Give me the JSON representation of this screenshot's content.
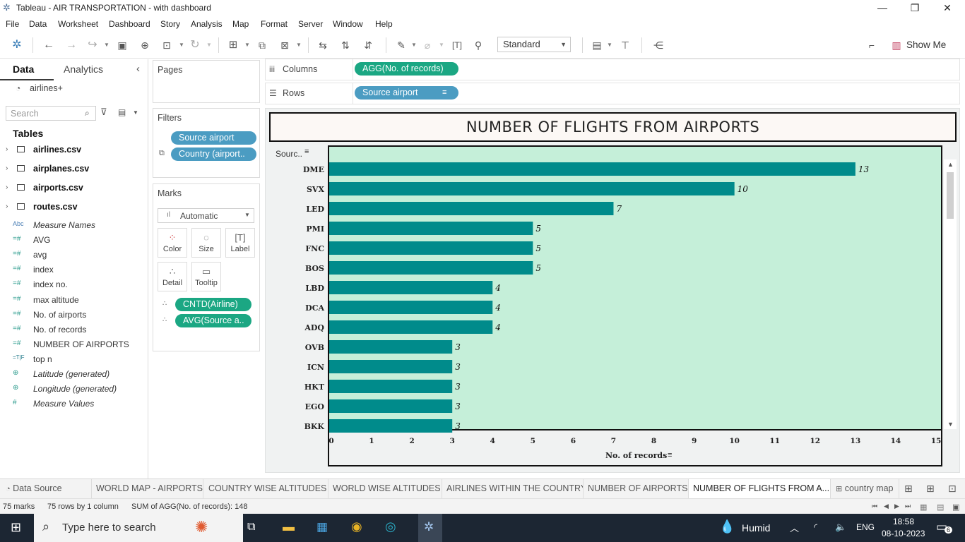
{
  "window": {
    "title": "Tableau - AIR TRANSPORTATION - with dashboard"
  },
  "menu": [
    "File",
    "Data",
    "Worksheet",
    "Dashboard",
    "Story",
    "Analysis",
    "Map",
    "Format",
    "Server",
    "Window",
    "Help"
  ],
  "toolbar": {
    "fit": "Standard",
    "show_me": "Show Me"
  },
  "datapane": {
    "tab_data": "Data",
    "tab_analytics": "Analytics",
    "datasource": "airlines+",
    "search_placeholder": "Search",
    "tables_heading": "Tables",
    "tables": [
      "airlines.csv",
      "airplanes.csv",
      "airports.csv",
      "routes.csv"
    ],
    "fields": [
      {
        "icon": "Abc",
        "label": "Measure Names",
        "italic": true
      },
      {
        "icon": "=#",
        "label": "AVG",
        "italic": false
      },
      {
        "icon": "=#",
        "label": "avg",
        "italic": false
      },
      {
        "icon": "=#",
        "label": "index",
        "italic": false
      },
      {
        "icon": "=#",
        "label": "index no.",
        "italic": false
      },
      {
        "icon": "=#",
        "label": "max altitude",
        "italic": false
      },
      {
        "icon": "=#",
        "label": "No. of airports",
        "italic": false
      },
      {
        "icon": "=#",
        "label": "No. of records",
        "italic": false
      },
      {
        "icon": "=#",
        "label": "NUMBER OF AIRPORTS",
        "italic": false
      },
      {
        "icon": "=T|F",
        "label": "top n",
        "italic": false
      },
      {
        "icon": "globe",
        "label": "Latitude (generated)",
        "italic": true
      },
      {
        "icon": "globe",
        "label": "Longitude (generated)",
        "italic": true
      },
      {
        "icon": "#",
        "label": "Measure Values",
        "italic": true
      }
    ]
  },
  "pages": {
    "title": "Pages"
  },
  "filters": {
    "title": "Filters",
    "items": [
      "Source airport",
      "Country (airport.."
    ]
  },
  "marks": {
    "title": "Marks",
    "type": "Automatic",
    "buttons": [
      "Color",
      "Size",
      "Label",
      "Detail",
      "Tooltip"
    ],
    "pills": [
      "CNTD(Airline)",
      "AVG(Source a.."
    ]
  },
  "shelves": {
    "columns_label": "Columns",
    "columns_pill": "AGG(No. of records)",
    "rows_label": "Rows",
    "rows_pill": "Source airport"
  },
  "chart_data": {
    "type": "bar",
    "orientation": "horizontal",
    "title": "NUMBER OF FLIGHTS FROM AIRPORTS",
    "row_header": "Sourc..",
    "xlabel": "No. of records",
    "xlim": [
      0,
      15
    ],
    "xticks": [
      0,
      1,
      2,
      3,
      4,
      5,
      6,
      7,
      8,
      9,
      10,
      11,
      12,
      13,
      14,
      15
    ],
    "categories": [
      "DME",
      "SVX",
      "LED",
      "PMI",
      "FNC",
      "BOS",
      "LBD",
      "DCA",
      "ADQ",
      "OVB",
      "ICN",
      "HKT",
      "EGO",
      "BKK"
    ],
    "values": [
      13,
      10,
      7,
      5,
      5,
      5,
      4,
      4,
      4,
      3,
      3,
      3,
      3,
      3
    ],
    "bar_color": "#008b8b",
    "background": "#c5efd9"
  },
  "sheet_tabs": [
    "Data Source",
    "WORLD MAP - AIRPORTS",
    "COUNTRY WISE ALTITUDES",
    "WORLD WISE ALTITUDES",
    "AIRLINES WITHIN THE COUNTRY",
    "NUMBER OF AIRPORTS",
    "NUMBER OF FLIGHTS FROM A...",
    "country map"
  ],
  "status": {
    "marks": "75 marks",
    "rows": "75 rows by 1 column",
    "sum": "SUM of AGG(No. of records): 148"
  },
  "taskbar": {
    "search": "Type here to search",
    "weather": "Humid",
    "lang": "ENG",
    "time": "18:58",
    "date": "08-10-2023",
    "notif_count": "6"
  }
}
